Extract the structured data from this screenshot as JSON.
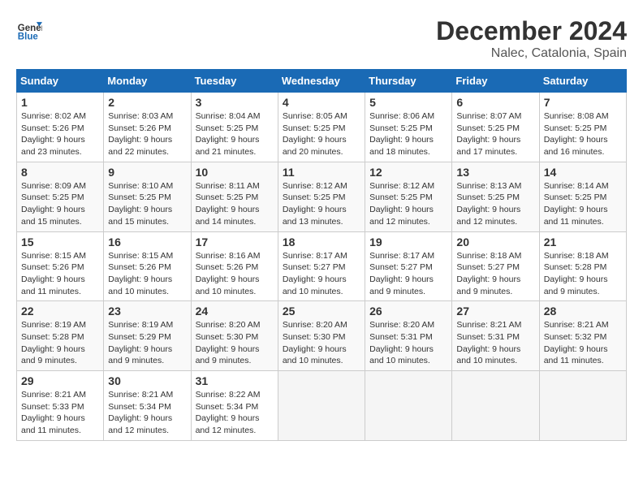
{
  "header": {
    "logo_line1": "General",
    "logo_line2": "Blue",
    "month": "December 2024",
    "location": "Nalec, Catalonia, Spain"
  },
  "weekdays": [
    "Sunday",
    "Monday",
    "Tuesday",
    "Wednesday",
    "Thursday",
    "Friday",
    "Saturday"
  ],
  "weeks": [
    [
      {
        "day": "1",
        "sunrise": "8:02 AM",
        "sunset": "5:26 PM",
        "daylight": "9 hours and 23 minutes."
      },
      {
        "day": "2",
        "sunrise": "8:03 AM",
        "sunset": "5:26 PM",
        "daylight": "9 hours and 22 minutes."
      },
      {
        "day": "3",
        "sunrise": "8:04 AM",
        "sunset": "5:25 PM",
        "daylight": "9 hours and 21 minutes."
      },
      {
        "day": "4",
        "sunrise": "8:05 AM",
        "sunset": "5:25 PM",
        "daylight": "9 hours and 20 minutes."
      },
      {
        "day": "5",
        "sunrise": "8:06 AM",
        "sunset": "5:25 PM",
        "daylight": "9 hours and 18 minutes."
      },
      {
        "day": "6",
        "sunrise": "8:07 AM",
        "sunset": "5:25 PM",
        "daylight": "9 hours and 17 minutes."
      },
      {
        "day": "7",
        "sunrise": "8:08 AM",
        "sunset": "5:25 PM",
        "daylight": "9 hours and 16 minutes."
      }
    ],
    [
      {
        "day": "8",
        "sunrise": "8:09 AM",
        "sunset": "5:25 PM",
        "daylight": "9 hours and 15 minutes."
      },
      {
        "day": "9",
        "sunrise": "8:10 AM",
        "sunset": "5:25 PM",
        "daylight": "9 hours and 15 minutes."
      },
      {
        "day": "10",
        "sunrise": "8:11 AM",
        "sunset": "5:25 PM",
        "daylight": "9 hours and 14 minutes."
      },
      {
        "day": "11",
        "sunrise": "8:12 AM",
        "sunset": "5:25 PM",
        "daylight": "9 hours and 13 minutes."
      },
      {
        "day": "12",
        "sunrise": "8:12 AM",
        "sunset": "5:25 PM",
        "daylight": "9 hours and 12 minutes."
      },
      {
        "day": "13",
        "sunrise": "8:13 AM",
        "sunset": "5:25 PM",
        "daylight": "9 hours and 12 minutes."
      },
      {
        "day": "14",
        "sunrise": "8:14 AM",
        "sunset": "5:25 PM",
        "daylight": "9 hours and 11 minutes."
      }
    ],
    [
      {
        "day": "15",
        "sunrise": "8:15 AM",
        "sunset": "5:26 PM",
        "daylight": "9 hours and 11 minutes."
      },
      {
        "day": "16",
        "sunrise": "8:15 AM",
        "sunset": "5:26 PM",
        "daylight": "9 hours and 10 minutes."
      },
      {
        "day": "17",
        "sunrise": "8:16 AM",
        "sunset": "5:26 PM",
        "daylight": "9 hours and 10 minutes."
      },
      {
        "day": "18",
        "sunrise": "8:17 AM",
        "sunset": "5:27 PM",
        "daylight": "9 hours and 10 minutes."
      },
      {
        "day": "19",
        "sunrise": "8:17 AM",
        "sunset": "5:27 PM",
        "daylight": "9 hours and 9 minutes."
      },
      {
        "day": "20",
        "sunrise": "8:18 AM",
        "sunset": "5:27 PM",
        "daylight": "9 hours and 9 minutes."
      },
      {
        "day": "21",
        "sunrise": "8:18 AM",
        "sunset": "5:28 PM",
        "daylight": "9 hours and 9 minutes."
      }
    ],
    [
      {
        "day": "22",
        "sunrise": "8:19 AM",
        "sunset": "5:28 PM",
        "daylight": "9 hours and 9 minutes."
      },
      {
        "day": "23",
        "sunrise": "8:19 AM",
        "sunset": "5:29 PM",
        "daylight": "9 hours and 9 minutes."
      },
      {
        "day": "24",
        "sunrise": "8:20 AM",
        "sunset": "5:30 PM",
        "daylight": "9 hours and 9 minutes."
      },
      {
        "day": "25",
        "sunrise": "8:20 AM",
        "sunset": "5:30 PM",
        "daylight": "9 hours and 10 minutes."
      },
      {
        "day": "26",
        "sunrise": "8:20 AM",
        "sunset": "5:31 PM",
        "daylight": "9 hours and 10 minutes."
      },
      {
        "day": "27",
        "sunrise": "8:21 AM",
        "sunset": "5:31 PM",
        "daylight": "9 hours and 10 minutes."
      },
      {
        "day": "28",
        "sunrise": "8:21 AM",
        "sunset": "5:32 PM",
        "daylight": "9 hours and 11 minutes."
      }
    ],
    [
      {
        "day": "29",
        "sunrise": "8:21 AM",
        "sunset": "5:33 PM",
        "daylight": "9 hours and 11 minutes."
      },
      {
        "day": "30",
        "sunrise": "8:21 AM",
        "sunset": "5:34 PM",
        "daylight": "9 hours and 12 minutes."
      },
      {
        "day": "31",
        "sunrise": "8:22 AM",
        "sunset": "5:34 PM",
        "daylight": "9 hours and 12 minutes."
      },
      null,
      null,
      null,
      null
    ]
  ]
}
